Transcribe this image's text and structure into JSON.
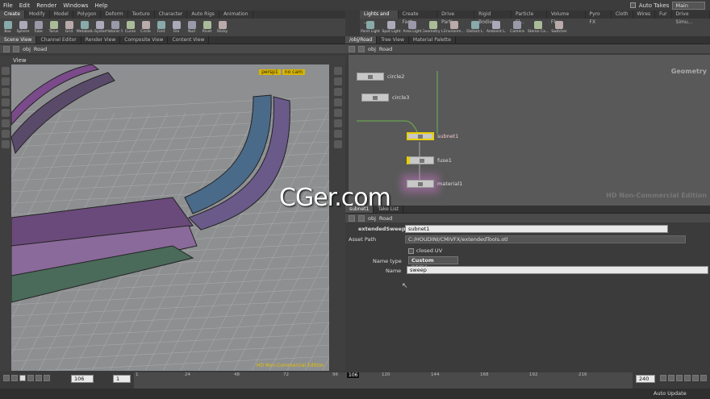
{
  "menubar": {
    "items": [
      "File",
      "Edit",
      "Render",
      "Windows",
      "Help"
    ],
    "auto_takes": "Auto Takes",
    "desktop": "Main"
  },
  "shelf_left": {
    "tabs": [
      "Create",
      "Modify",
      "Model",
      "Polygon",
      "Deform",
      "Texture",
      "Character",
      "Auto Rigs",
      "Animation"
    ],
    "tools": [
      "Box",
      "Sphere",
      "Tube",
      "Torus",
      "Grid",
      "Metaball",
      "L-System",
      "Platonic S.",
      "Curve",
      "Circle",
      "Font",
      "File",
      "Null",
      "Rivet",
      "Sticky"
    ]
  },
  "shelf_right": {
    "tabs": [
      "Lights and ...",
      "Create Fact...",
      "Drive Parti...",
      "Rigid Bodies",
      "Particle Fl...",
      "Volume Flu...",
      "Pyro FX",
      "Cloth",
      "Wires",
      "Fur",
      "Drive Simu..."
    ],
    "tools": [
      "Point Light",
      "Spot Light",
      "Area Light",
      "Geometry L.",
      "Environm...",
      "Distant L.",
      "Ambient L.",
      "Camera",
      "Stereo Ca...",
      "Switcher"
    ]
  },
  "left_tabs": [
    "Scene View",
    "Channel Editor",
    "Render View",
    "Composite View",
    "Content View"
  ],
  "left_path": {
    "root": "obj",
    "node": "Road"
  },
  "view_label": "View",
  "viewport": {
    "persp": "persp1",
    "cam": "no cam",
    "watermark": "HD Non-Commercial Edition"
  },
  "net_tabs": [
    "/obj/Road",
    "Tree View",
    "Material Palette"
  ],
  "net_path": {
    "root": "obj",
    "node": "Road"
  },
  "net_context": "Geometry",
  "net_watermark": "HD Non-Commercial Edition",
  "logo": "CGer.com",
  "nodes": [
    "circle2",
    "circle3",
    "subnet1",
    "fuse1",
    "material1"
  ],
  "param_tabs": [
    "subnet1",
    "Take List"
  ],
  "param_path": {
    "root": "obj",
    "node": "Road"
  },
  "params": {
    "type": "extendedSweep",
    "name": "subnet1",
    "asset_path_label": "Asset Path",
    "asset_path": "C:/HOUDINI/CMIVFX/extendedTools.otl",
    "closed_uv": "closed UV",
    "name_type_label": "Name type",
    "name_type": "Custom name",
    "name_label": "Name",
    "name_value": "sweep"
  },
  "timeline": {
    "frame": "106",
    "step": "1",
    "ticks": [
      "1",
      "24",
      "48",
      "72",
      "96",
      "120",
      "144",
      "168",
      "192",
      "216"
    ],
    "end": "240",
    "current": "106"
  },
  "bottombar": {
    "auto_update": "Auto Update"
  },
  "colors": {
    "accent": "#f0c000",
    "bg": "#3b3b3b",
    "viewport": "#8d8f91",
    "network": "#595959"
  }
}
